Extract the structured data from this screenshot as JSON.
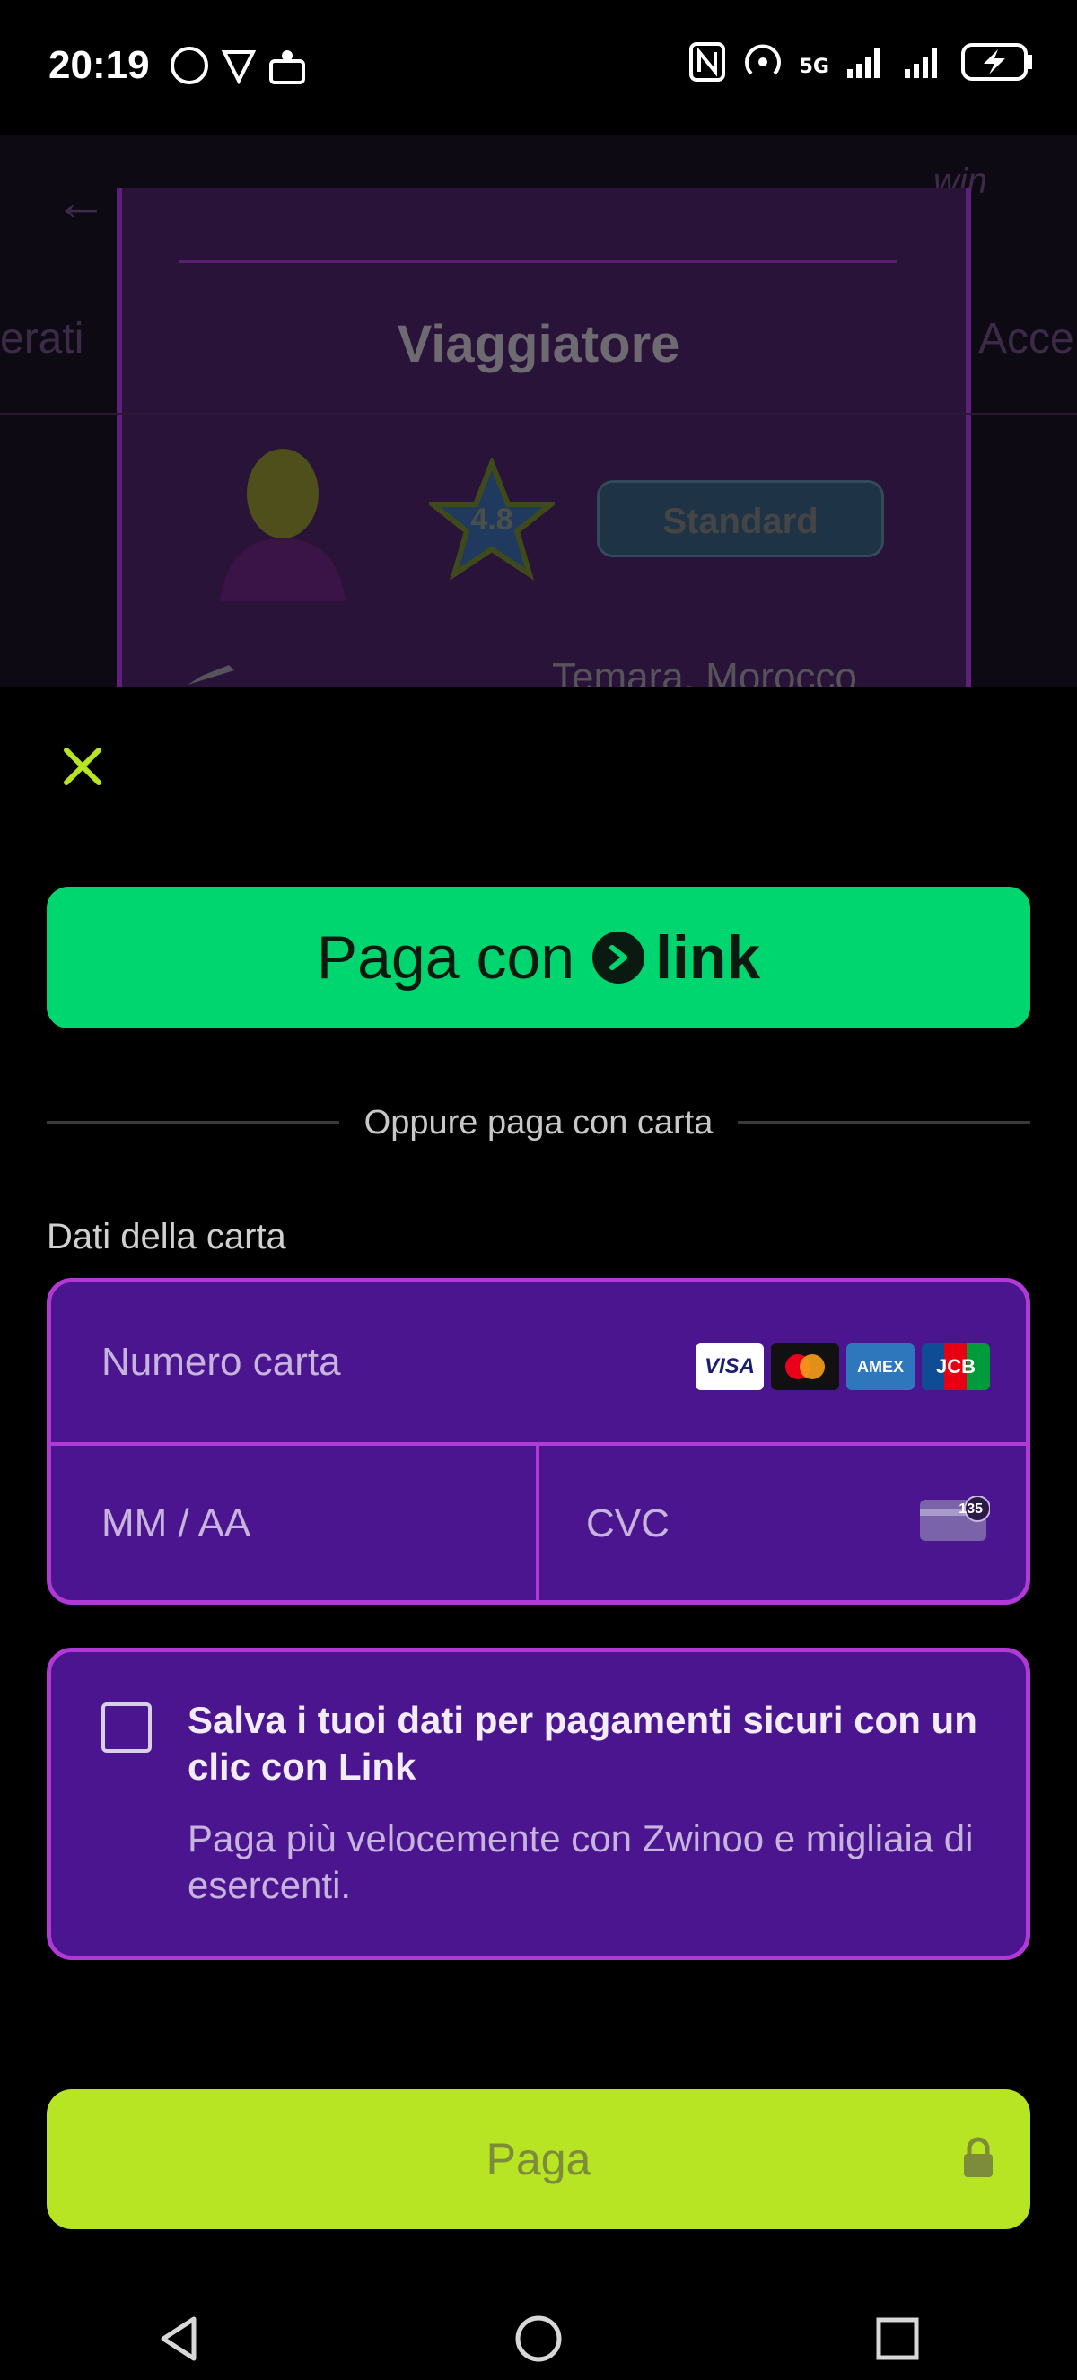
{
  "status_bar": {
    "time": "20:19",
    "network": "5G"
  },
  "background_app": {
    "title": "Viaggiatore",
    "rating": "4.8",
    "badge": "Standard",
    "location": "Temara, Morocco",
    "side_left": "erati",
    "side_right": "Acce",
    "logo": "win"
  },
  "sheet": {
    "close_icon": "close-icon",
    "link_button": {
      "label": "Paga con",
      "brand": "link"
    },
    "divider_text": "Oppure paga con carta",
    "card_label": "Dati della carta",
    "card_number_placeholder": "Numero carta",
    "brands": [
      "VISA",
      "MC",
      "AMEX",
      "JCB"
    ],
    "expiry_placeholder": "MM / AA",
    "cvc_placeholder": "CVC",
    "cvc_icon_text": "135",
    "save_title": "Salva i tuoi dati per pagamenti sicuri con un clic con Link",
    "save_subtitle": "Paga più velocemente con Zwinoo e migliaia di esercenti.",
    "pay_button": "Paga"
  },
  "colors": {
    "link_green": "#00d66f",
    "card_purple": "#4b1590",
    "card_border": "#b13ad6",
    "pay_lime": "#b7e423"
  }
}
